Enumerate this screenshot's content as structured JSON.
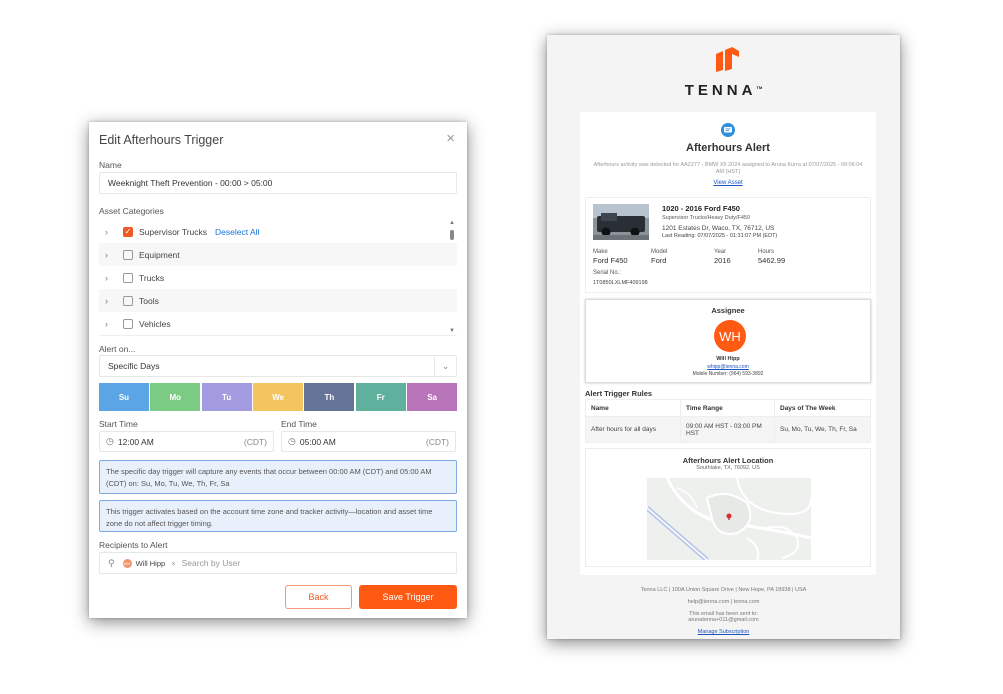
{
  "dialog": {
    "title": "Edit Afterhours Trigger",
    "close_glyph": "×",
    "name_label": "Name",
    "name_value": "Weeknight Theft Prevention - 00:00 > 05:00",
    "asset_categories_label": "Asset Categories",
    "categories": [
      {
        "label": "Supervisor Trucks",
        "checked": true
      },
      {
        "label": "Equipment",
        "checked": false
      },
      {
        "label": "Trucks",
        "checked": false
      },
      {
        "label": "Tools",
        "checked": false
      },
      {
        "label": "Vehicles",
        "checked": false
      }
    ],
    "deselect_all": "Deselect All",
    "alert_on_label": "Alert on...",
    "alert_on_value": "Specific Days",
    "days": [
      {
        "label": "Su",
        "color": "#5ba4e6"
      },
      {
        "label": "Mo",
        "color": "#7ccb85"
      },
      {
        "label": "Tu",
        "color": "#a29be0"
      },
      {
        "label": "We",
        "color": "#f4c55f"
      },
      {
        "label": "Th",
        "color": "#67749a"
      },
      {
        "label": "Fr",
        "color": "#5fb19d"
      },
      {
        "label": "Sa",
        "color": "#b874b8"
      }
    ],
    "start_time_label": "Start Time",
    "start_time_value": "12:00 AM",
    "start_tz": "(CDT)",
    "end_time_label": "End Time",
    "end_time_value": "05:00 AM",
    "end_tz": "(CDT)",
    "info_1": "The specific day trigger will capture any events that occur between 00:00 AM (CDT) and 05:00 AM (CDT) on: Su, Mo, Tu, We, Th, Fr, Sa",
    "info_2": "This trigger activates based on the account time zone and tracker activity—location and asset time zone do not affect trigger timing.",
    "recipients_label": "Recipients to Alert",
    "recipient_chip": "Will Hipp",
    "recipient_initials": "WH",
    "recipient_remove": "×",
    "search_placeholder": "Search by User",
    "back_label": "Back",
    "save_label": "Save Trigger",
    "accent": "#ff5a14"
  },
  "email": {
    "brand": "TENNA",
    "brand_tm": "TM",
    "title": "Afterhours Alert",
    "description": "Afterhours activity was detected for AA2277 - BMW X5 2024 assigned to Aruna Kurra at 07/07/2025 - 09:06:04 AM (HST)",
    "view_asset": "View Asset",
    "asset": {
      "name": "1020 - 2016 Ford F450",
      "type": "Supervisor Trucks/Heavy Duty/F450",
      "address": "1201 Estates Dr, Waco, TX, 76712, US",
      "last_reading": "Last Reading: 07/07/2025 - 01:31:07 PM (EDT)",
      "make_label": "Make",
      "make": "Ford F450",
      "model_label": "Model",
      "model": "Ford",
      "year_label": "Year",
      "year": "2016",
      "hours_label": "Hours",
      "hours": "5462.99",
      "serial_label": "Serial No.:",
      "serial": "1T0850LXLMF409198"
    },
    "assignee": {
      "heading": "Assignee",
      "initials": "WH",
      "name": "Will Hipp",
      "email": "whipp@tenna.com",
      "phone": "Mobile Number: (964) 593-3892"
    },
    "rules_heading": "Alert Trigger Rules",
    "rules_headers": [
      "Name",
      "Time Range",
      "Days of The Week"
    ],
    "rules_row": [
      "After hours for all days",
      "09:00 AM HST - 03:00 PM HST",
      "Su, Mo, Tu, We, Th, Fr, Sa"
    ],
    "location_heading": "Afterhours Alert Location",
    "location_sub": "Southlake, TX, 76092, US",
    "footer_address": "Tenna LLC | 100A Union Square Drive | New Hope, PA 18938 | USA",
    "footer_contact": "help@tenna.com | tenna.com",
    "footer_sent": "This email has been sent to:",
    "footer_email": "arunatenna+011@gmail.com",
    "manage": "Manage Subscription",
    "brand_color": "#ff5a14"
  }
}
